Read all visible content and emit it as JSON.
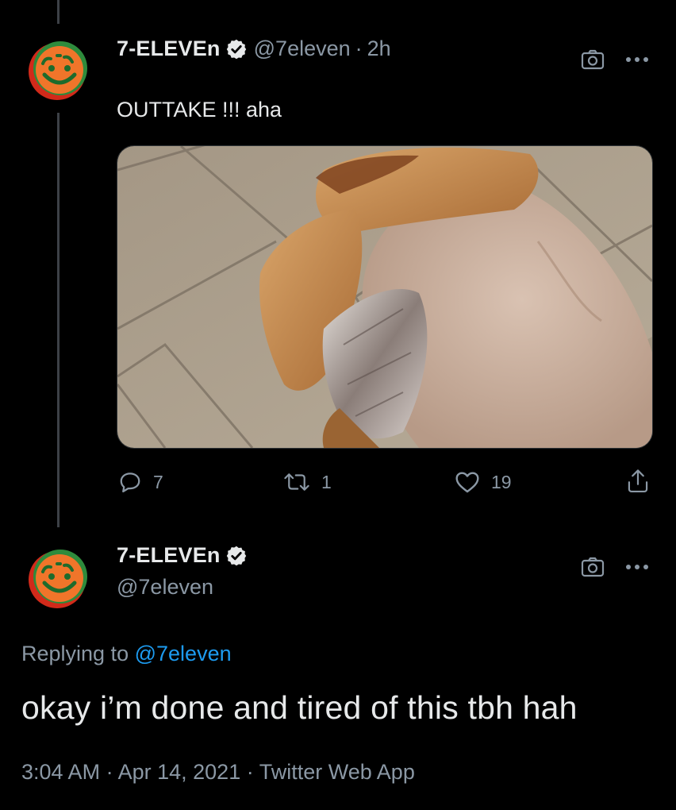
{
  "tweet1": {
    "display_name": "7-ELEVEn",
    "handle": "@7eleven",
    "separator": "·",
    "age": "2h",
    "text": "OUTTAKE !!! aha",
    "media_icon": "camera-icon",
    "more_icon": "more-icon",
    "actions": {
      "reply": {
        "icon": "reply-icon",
        "count": "7"
      },
      "retweet": {
        "icon": "retweet-icon",
        "count": "1"
      },
      "like": {
        "icon": "like-icon",
        "count": "19"
      },
      "share": {
        "icon": "share-icon"
      }
    }
  },
  "tweet2": {
    "display_name": "7-ELEVEn",
    "handle": "@7eleven",
    "replying_prefix": "Replying to",
    "replying_handle": "@7eleven",
    "text": "okay i’m done and tired of this tbh hah",
    "time": "3:04 AM",
    "sep1": "·",
    "date": "Apr 14, 2021",
    "sep2": "·",
    "source": "Twitter Web App"
  },
  "colors": {
    "background": "#000000",
    "text": "#e7e9ea",
    "muted": "#8b98a5",
    "link": "#1d9bf0",
    "thread_line": "#3d4147"
  }
}
